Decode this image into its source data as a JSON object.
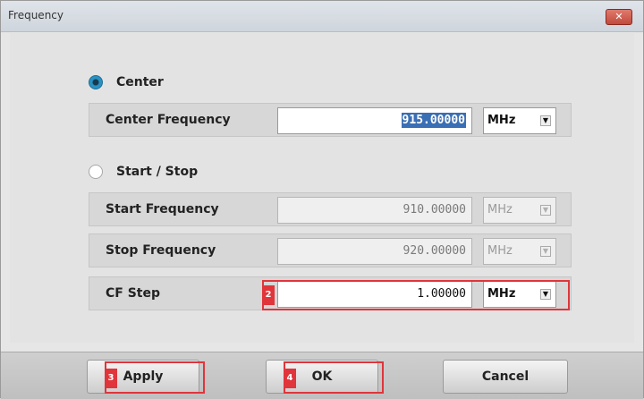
{
  "window": {
    "title": "Frequency",
    "close_symbol": "✕"
  },
  "center_radio": {
    "label": "Center",
    "checked": true
  },
  "center_frequency": {
    "label": "Center Frequency",
    "value": "915.00000",
    "unit": "MHz"
  },
  "startstop_radio": {
    "label": "Start / Stop",
    "checked": false
  },
  "start_frequency": {
    "label": "Start Frequency",
    "value": "910.00000",
    "unit": "MHz"
  },
  "stop_frequency": {
    "label": "Stop Frequency",
    "value": "920.00000",
    "unit": "MHz"
  },
  "cf_step": {
    "label": "CF Step",
    "value": "1.00000",
    "unit": "MHz"
  },
  "dropdown_arrow": "▼",
  "markers": {
    "cf_step": "2",
    "apply": "3",
    "ok": "4"
  },
  "buttons": {
    "apply": "Apply",
    "ok": "OK",
    "cancel": "Cancel"
  },
  "colors": {
    "highlight": "#e0353b",
    "selection": "#3a6fb5",
    "radio_active": "#2a91c2"
  }
}
